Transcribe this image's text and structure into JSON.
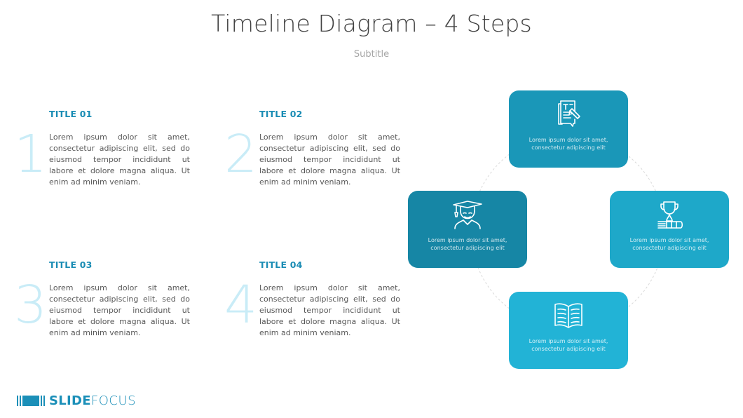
{
  "header": {
    "title": "Timeline Diagram – 4 Steps",
    "subtitle": "Subtitle"
  },
  "steps": [
    {
      "number": "1",
      "title": "TITLE 01",
      "body": "Lorem ipsum dolor sit amet, consectetur adipiscing elit, sed do eiusmod tempor incididunt ut labore et dolore magna aliqua. Ut enim ad minim veniam."
    },
    {
      "number": "2",
      "title": "TITLE 02",
      "body": "Lorem ipsum dolor sit amet, consectetur adipiscing elit, sed do eiusmod tempor incididunt ut labore et dolore magna aliqua. Ut enim ad minim veniam."
    },
    {
      "number": "3",
      "title": "TITLE 03",
      "body": "Lorem ipsum dolor sit amet, consectetur adipiscing elit, sed do eiusmod tempor incididunt ut labore et dolore magna aliqua. Ut enim ad minim veniam."
    },
    {
      "number": "4",
      "title": "TITLE 04",
      "body": "Lorem ipsum dolor sit amet, consectetur adipiscing elit, sed do eiusmod tempor incididunt ut labore et dolore magna aliqua. Ut enim ad minim veniam."
    }
  ],
  "cards": [
    {
      "position": "top",
      "icon": "document-edit-icon",
      "color": "#1a97b8",
      "text_line1": "Lorem ipsum dolor sit amet,",
      "text_line2": "consectetur adipiscing elit"
    },
    {
      "position": "left",
      "icon": "graduate-icon",
      "color": "#1686a5",
      "text_line1": "Lorem ipsum dolor sit amet,",
      "text_line2": "consectetur adipiscing elit"
    },
    {
      "position": "right",
      "icon": "trophy-books-icon",
      "color": "#1ea8c9",
      "text_line1": "Lorem ipsum dolor sit amet,",
      "text_line2": "consectetur adipiscing elit"
    },
    {
      "position": "bottom",
      "icon": "open-book-icon",
      "color": "#22b3d6",
      "text_line1": "Lorem ipsum dolor sit amet,",
      "text_line2": "consectetur adipiscing elit"
    }
  ],
  "colors": {
    "accent": "#1a8cb4",
    "number_tint": "#c9ecf7",
    "title_text": "#404040"
  },
  "logo": {
    "bold": "SLIDE",
    "light": "FOCUS"
  }
}
